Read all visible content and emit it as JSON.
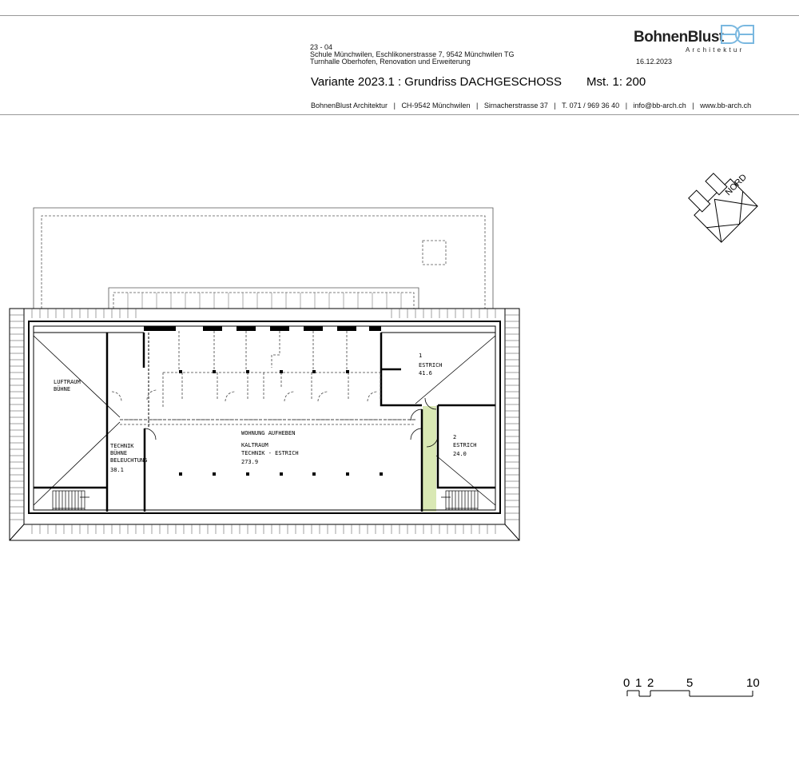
{
  "header": {
    "project_number": "23 - 04",
    "project_line1": "Schule Münchwilen, Eschlikonerstrasse 7, 9542 Münchwilen TG",
    "project_line2": "Turnhalle Oberhofen, Renovation und Erweiterung",
    "date": "16.12.2023",
    "drawing_title": "Variante 2023.1 : Grundriss DACHGESCHOSS",
    "scale": "Mst. 1: 200",
    "contact": {
      "company": "BohnenBlust Architektur",
      "city": "CH-9542 Münchwilen",
      "street": "Sirnacherstrasse 37",
      "phone": "T. 071 / 969 36 40",
      "email": "info@bb-arch.ch",
      "web": "www.bb-arch.ch",
      "separator": "|"
    }
  },
  "logo": {
    "name": "BohnenBlust",
    "subtitle": "Architektur",
    "color": "#7ab8e0"
  },
  "north": {
    "label": "NORD"
  },
  "rooms": {
    "luftraum": {
      "line1": "LUFTRAUM",
      "line2": "BÜHNE"
    },
    "technik": {
      "line1": "TECHNIK",
      "line2": "BÜHNE",
      "line3": "BELEUCHTUNG",
      "area": "38.1"
    },
    "wohnung": {
      "note": "WOHNUNG AUFHEBEN",
      "line1": "KALTRAUM",
      "line2": "TECHNIK - ESTRICH",
      "area": "273.9"
    },
    "estrich1": {
      "number": "1",
      "name": "ESTRICH",
      "area": "41.6"
    },
    "estrich2": {
      "number": "2",
      "name": "ESTRICH",
      "area": "24.0"
    }
  },
  "scale_bar": {
    "labels": [
      "0",
      "1",
      "2",
      "5",
      "10"
    ]
  },
  "colors": {
    "highlight": "#d9e8b4",
    "wall": "#000000",
    "line": "#555555"
  }
}
